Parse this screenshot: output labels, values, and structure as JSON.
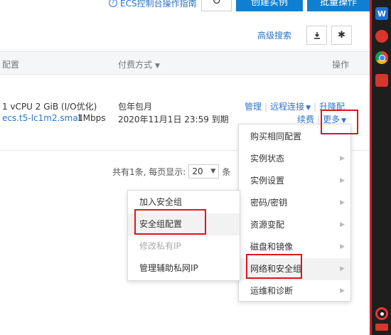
{
  "toolbar": {
    "guide_label": "ECS控制台操作指南",
    "refresh_icon": "refresh-icon",
    "create_label": "创建实例",
    "batch_label": "批量操作",
    "advanced_search": "高级搜索",
    "download_icon": "download-icon",
    "settings_icon": "gear-icon"
  },
  "table": {
    "headers": {
      "config": "配置",
      "payment": "付费方式",
      "actions": "操作"
    },
    "row": {
      "spec": "1 vCPU 2 GiB (I/O优化)",
      "instance_type": "ecs.t5-lc1m2.small",
      "bandwidth": "1Mbps",
      "pay_type": "包年包月",
      "expiry": "2020年11月1日 23:59 到期",
      "actions": {
        "manage": "管理",
        "remote": "远程连接",
        "upgrade": "升降配",
        "renew": "续费",
        "more": "更多"
      }
    }
  },
  "pager": {
    "summary": "共有1条, 每页显示:",
    "page_size": "20",
    "unit": "条"
  },
  "more_menu": [
    {
      "label": "购买相同配置",
      "has_submenu": false
    },
    {
      "label": "实例状态",
      "has_submenu": true
    },
    {
      "label": "实例设置",
      "has_submenu": true
    },
    {
      "label": "密码/密钥",
      "has_submenu": true
    },
    {
      "label": "资源变配",
      "has_submenu": true
    },
    {
      "label": "磁盘和镜像",
      "has_submenu": true
    },
    {
      "label": "网络和安全组",
      "has_submenu": true
    },
    {
      "label": "运维和诊断",
      "has_submenu": true
    }
  ],
  "network_submenu": [
    {
      "label": "加入安全组",
      "disabled": false
    },
    {
      "label": "安全组配置",
      "disabled": false
    },
    {
      "label": "修改私有IP",
      "disabled": true
    },
    {
      "label": "管理辅助私网IP",
      "disabled": false
    }
  ],
  "colors": {
    "link": "#2b75c6",
    "primary_button": "#0f7fd1",
    "highlight_box": "#e0141b"
  }
}
